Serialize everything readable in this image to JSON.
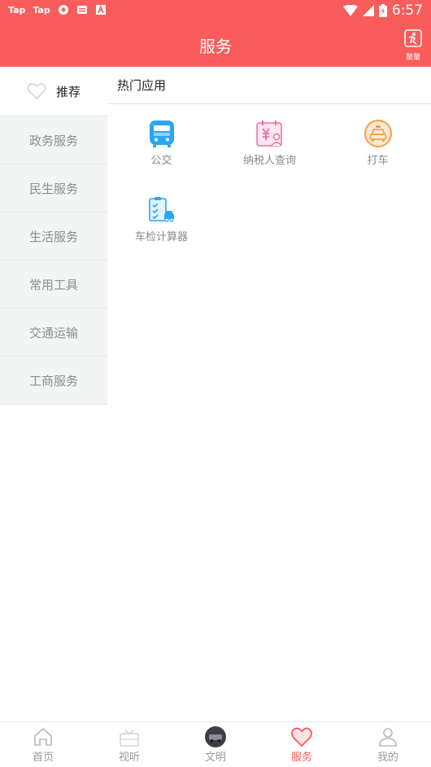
{
  "status_bar": {
    "left_items": [
      "Tap",
      "Tap"
    ],
    "time": "6:57"
  },
  "app_bar": {
    "title": "服务",
    "action_label": "聚聚"
  },
  "sidebar": {
    "items": [
      {
        "label": "推荐",
        "icon": "heart-outline-icon",
        "active": true
      },
      {
        "label": "政务服务"
      },
      {
        "label": "民生服务"
      },
      {
        "label": "生活服务"
      },
      {
        "label": "常用工具"
      },
      {
        "label": "交通运输"
      },
      {
        "label": "工商服务"
      }
    ]
  },
  "main": {
    "section_title": "热门应用",
    "apps": [
      {
        "label": "公交",
        "icon": "bus-icon",
        "color": "#2aa6f2"
      },
      {
        "label": "纳税人查询",
        "icon": "tax-calendar-icon",
        "color": "#f06ea0"
      },
      {
        "label": "打车",
        "icon": "taxi-icon",
        "color": "#f5a04a"
      },
      {
        "label": "车检计算器",
        "icon": "car-inspection-icon",
        "color": "#2aa6f2"
      }
    ]
  },
  "tab_bar": {
    "tabs": [
      {
        "label": "首页",
        "icon": "home-icon"
      },
      {
        "label": "视听",
        "icon": "tv-icon"
      },
      {
        "label": "文明",
        "icon": "avatar-icon"
      },
      {
        "label": "服务",
        "icon": "heart-icon",
        "active": true
      },
      {
        "label": "我的",
        "icon": "user-icon"
      }
    ]
  },
  "colors": {
    "brand": "#f85c5b",
    "sidebar_bg": "#f3f4f4",
    "muted_text": "#8e8e8e"
  }
}
